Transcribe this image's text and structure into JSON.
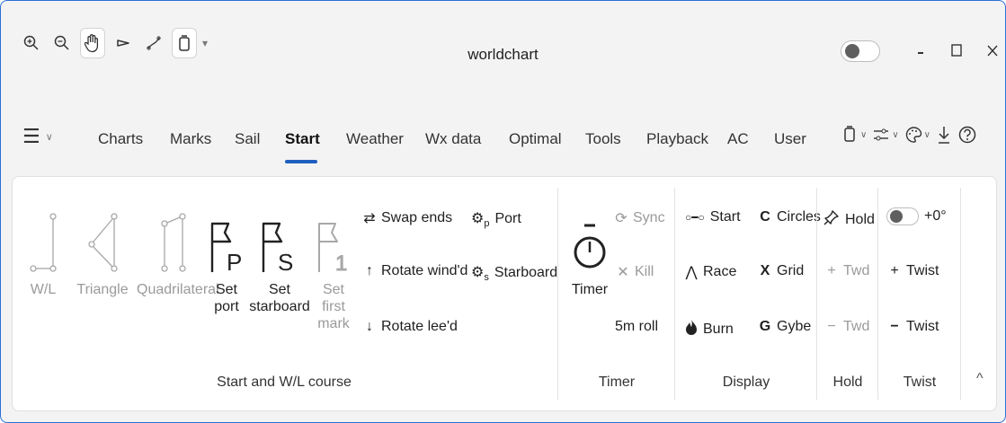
{
  "window": {
    "title": "worldchart"
  },
  "quick_access": [
    "zoom-in-icon",
    "zoom-out-icon",
    "hand-icon",
    "lasso-icon",
    "measure-icon",
    "copy-icon",
    "overflow-icon"
  ],
  "tabs": {
    "menu_icon": "hamburger-icon",
    "items": [
      "Charts",
      "Marks",
      "Sail",
      "Start",
      "Weather",
      "Wx data",
      "Optimal",
      "Tools",
      "Playback",
      "AC",
      "User"
    ],
    "active": "Start"
  },
  "ribbon": {
    "course": {
      "label": "Start and W/L course",
      "wl": "W/L",
      "triangle": "Triangle",
      "quadrilateral": "Quadrilateral",
      "set_port": [
        "Set",
        "port"
      ],
      "set_starboard": [
        "Set",
        "starboard"
      ],
      "set_first_mark": [
        "Set first",
        "mark"
      ],
      "swap_ends": "Swap ends",
      "rotate_windward": "Rotate wind'd",
      "rotate_leeward": "Rotate lee'd",
      "port": "Port",
      "starboard": "Starboard",
      "flag_port_letter": "P",
      "flag_starboard_letter": "S",
      "flag_first_letter": "1"
    },
    "timer": {
      "label": "Timer",
      "timer": "Timer",
      "sync": "Sync",
      "kill": "Kill",
      "roll": "5m roll"
    },
    "display": {
      "label": "Display",
      "start": "Start",
      "race": "Race",
      "burn": "Burn",
      "circles": "Circles",
      "grid": "Grid",
      "gybe": "Gybe",
      "circles_key": "C",
      "grid_key": "X",
      "gybe_key": "G"
    },
    "hold": {
      "label": "Hold",
      "hold": "Hold",
      "plus_twd": "Twd",
      "minus_twd": "Twd"
    },
    "twist": {
      "label": "Twist",
      "angle": "+0°",
      "plus_twist": "Twist",
      "minus_twist": "Twist"
    },
    "collapse": "^"
  },
  "colors": {
    "accent": "#1f5fbf",
    "window_border": "#2a6fd6",
    "disabled": "#9a9a9a"
  }
}
